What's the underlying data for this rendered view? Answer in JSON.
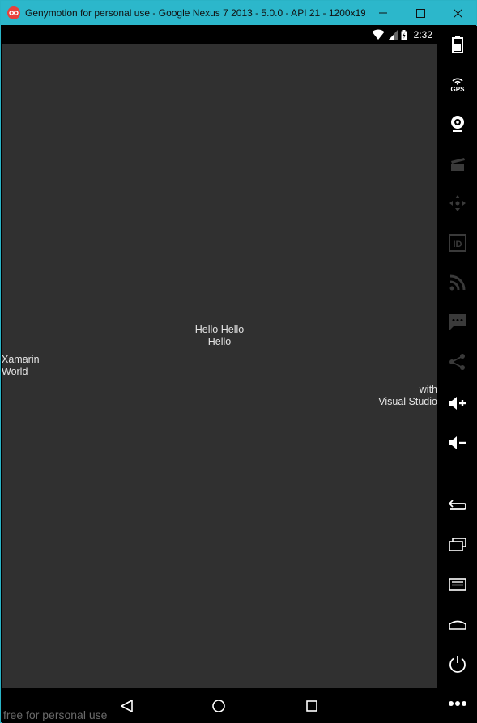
{
  "window": {
    "title": "Genymotion for personal use - Google Nexus 7 2013 - 5.0.0 - API 21 - 1200x19...",
    "accent": "#2cb7cb"
  },
  "statusbar": {
    "time": "2:32"
  },
  "content": {
    "label_center": "Hello Hello\nHello",
    "label_left": "Xamarin\nWorld",
    "label_right": "with\nVisual Studio",
    "background": "#303030"
  },
  "navbar": {
    "watermark": "free for personal use"
  },
  "toolbar": {
    "items": [
      "battery-icon",
      "gps-icon",
      "webcam-icon",
      "capture-icon",
      "dpad-icon",
      "device-id-icon",
      "network-icon",
      "sms-icon",
      "share-icon",
      "volume-up-icon",
      "volume-down-icon",
      "back-icon",
      "recent-apps-icon",
      "menu-icon",
      "home-icon",
      "power-icon",
      "more-icon"
    ],
    "gps_text": "GPS",
    "id_text": "ID"
  }
}
